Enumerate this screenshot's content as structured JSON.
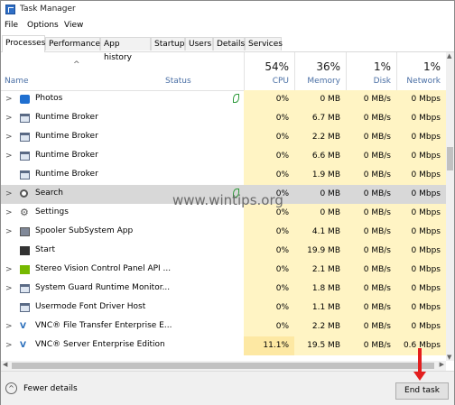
{
  "window": {
    "title": "Task Manager"
  },
  "menu": [
    "File",
    "Options",
    "View"
  ],
  "tabs": [
    "Processes",
    "Performance",
    "App history",
    "Startup",
    "Users",
    "Details",
    "Services"
  ],
  "columns": {
    "name": "Name",
    "status": "Status",
    "cpu": {
      "pct": "54%",
      "label": "CPU"
    },
    "memory": {
      "pct": "36%",
      "label": "Memory"
    },
    "disk": {
      "pct": "1%",
      "label": "Disk"
    },
    "network": {
      "pct": "1%",
      "label": "Network"
    }
  },
  "processes": [
    {
      "name": "Photos",
      "icon": "photos-icon",
      "cpu": "0%",
      "memory": "0 MB",
      "disk": "0 MB/s",
      "network": "0 Mbps"
    },
    {
      "name": "Runtime Broker",
      "icon": "window-icon",
      "cpu": "0%",
      "memory": "6.7 MB",
      "disk": "0 MB/s",
      "network": "0 Mbps"
    },
    {
      "name": "Runtime Broker",
      "icon": "window-icon",
      "cpu": "0%",
      "memory": "2.2 MB",
      "disk": "0 MB/s",
      "network": "0 Mbps"
    },
    {
      "name": "Runtime Broker",
      "icon": "window-icon",
      "cpu": "0%",
      "memory": "6.6 MB",
      "disk": "0 MB/s",
      "network": "0 Mbps"
    },
    {
      "name": "Runtime Broker",
      "icon": "window-icon",
      "cpu": "0%",
      "memory": "1.9 MB",
      "disk": "0 MB/s",
      "network": "0 Mbps"
    },
    {
      "name": "Search",
      "icon": "search-icon",
      "cpu": "0%",
      "memory": "0 MB",
      "disk": "0 MB/s",
      "network": "0 Mbps"
    },
    {
      "name": "Settings",
      "icon": "gear-icon",
      "cpu": "0%",
      "memory": "0 MB",
      "disk": "0 MB/s",
      "network": "0 Mbps"
    },
    {
      "name": "Spooler SubSystem App",
      "icon": "printer-icon",
      "cpu": "0%",
      "memory": "4.1 MB",
      "disk": "0 MB/s",
      "network": "0 Mbps"
    },
    {
      "name": "Start",
      "icon": "start-icon",
      "cpu": "0%",
      "memory": "19.9 MB",
      "disk": "0 MB/s",
      "network": "0 Mbps"
    },
    {
      "name": "Stereo Vision Control Panel API ...",
      "icon": "nvidia-icon",
      "cpu": "0%",
      "memory": "2.1 MB",
      "disk": "0 MB/s",
      "network": "0 Mbps"
    },
    {
      "name": "System Guard Runtime Monitor...",
      "icon": "window-icon",
      "cpu": "0%",
      "memory": "1.8 MB",
      "disk": "0 MB/s",
      "network": "0 Mbps"
    },
    {
      "name": "Usermode Font Driver Host",
      "icon": "window-icon",
      "cpu": "0%",
      "memory": "1.1 MB",
      "disk": "0 MB/s",
      "network": "0 Mbps"
    },
    {
      "name": "VNC® File Transfer Enterprise E...",
      "icon": "vnc-icon",
      "cpu": "0%",
      "memory": "2.2 MB",
      "disk": "0 MB/s",
      "network": "0 Mbps"
    },
    {
      "name": "VNC® Server Enterprise Edition",
      "icon": "vnc-icon",
      "cpu": "11.1%",
      "memory": "19.5 MB",
      "disk": "0 MB/s",
      "network": "0.6 Mbps"
    }
  ],
  "watermark": "www.wintips.org",
  "footer": {
    "fewer_details": "Fewer details",
    "end_task": "End task"
  },
  "colors": {
    "cpu_tint": "#fff4c4",
    "cpu_tint_strong": "#fde8a3",
    "mem_tint": "#fff4c4",
    "selected_row": "#d8d8d8",
    "arrow": "#e31e1e"
  }
}
